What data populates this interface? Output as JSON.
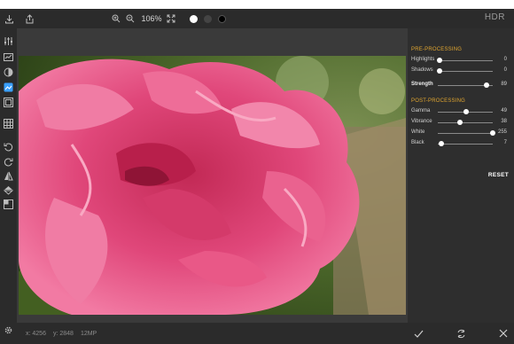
{
  "app": {
    "title": "HDR"
  },
  "toolbar": {
    "zoom_level": "106%",
    "swatches": [
      "#ffffff",
      "#3a3a3a",
      "#000000"
    ]
  },
  "status": {
    "x": "x: 4256",
    "y": "y: 2848",
    "mp": "12MP"
  },
  "panel": {
    "pre_title": "PRE-PROCESSING",
    "post_title": "POST-PROCESSING",
    "pre": [
      {
        "label": "Highlights",
        "value": "0",
        "level": 0.0
      },
      {
        "label": "Shadows",
        "value": "0",
        "level": 0.0
      },
      {
        "label": "Strength",
        "value": "89",
        "level": 0.89
      }
    ],
    "post": [
      {
        "label": "Gamma",
        "value": "49",
        "level": 0.49
      },
      {
        "label": "Vibrance",
        "value": "38",
        "level": 0.38
      },
      {
        "label": "White",
        "value": "255",
        "level": 1.0
      },
      {
        "label": "Black",
        "value": "7",
        "level": 0.03
      }
    ],
    "reset_label": "RESET"
  },
  "icons": {
    "import": "import-icon",
    "share": "share-icon",
    "zoom_in": "zoom-in-icon",
    "zoom_out": "zoom-out-icon",
    "fit": "fit-screen-icon",
    "accept": "checkmark-icon",
    "reload": "refresh-icon",
    "cancel": "close-icon"
  }
}
